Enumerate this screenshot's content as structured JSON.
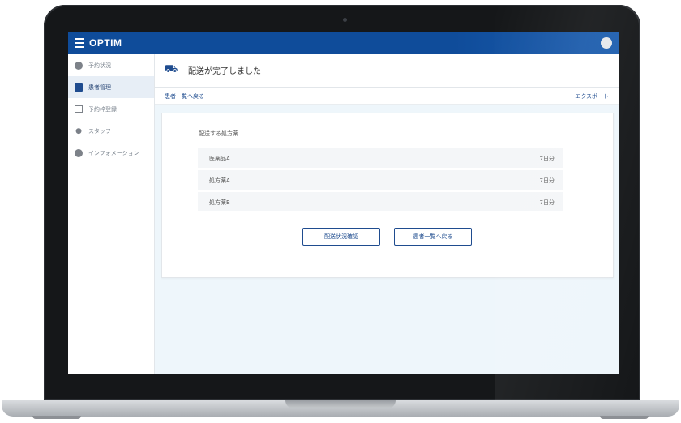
{
  "app": {
    "logo": "OPTIM"
  },
  "sidebar": {
    "items": [
      {
        "label": "予約状況",
        "icon": "clock-icon",
        "active": false
      },
      {
        "label": "患者管理",
        "icon": "person-card-icon",
        "active": true
      },
      {
        "label": "予約枠登録",
        "icon": "calendar-icon",
        "active": false
      },
      {
        "label": "スタッフ",
        "icon": "user-icon",
        "active": false
      },
      {
        "label": "インフォメーション",
        "icon": "info-icon",
        "active": false
      }
    ]
  },
  "page": {
    "title": "配送が完了しました",
    "back_link": "患者一覧へ戻る",
    "export_link": "エクスポート"
  },
  "card": {
    "section_label": "配送する処方薬",
    "items": [
      {
        "name": "医薬品A",
        "qty": "7日分"
      },
      {
        "name": "処方薬A",
        "qty": "7日分"
      },
      {
        "name": "処方薬B",
        "qty": "7日分"
      }
    ],
    "buttons": {
      "status": "配送状況確認",
      "list": "患者一覧へ戻る"
    }
  },
  "colors": {
    "brand": "#0f4c9a",
    "accent": "#1f4c8f",
    "background": "#eef6fb"
  }
}
